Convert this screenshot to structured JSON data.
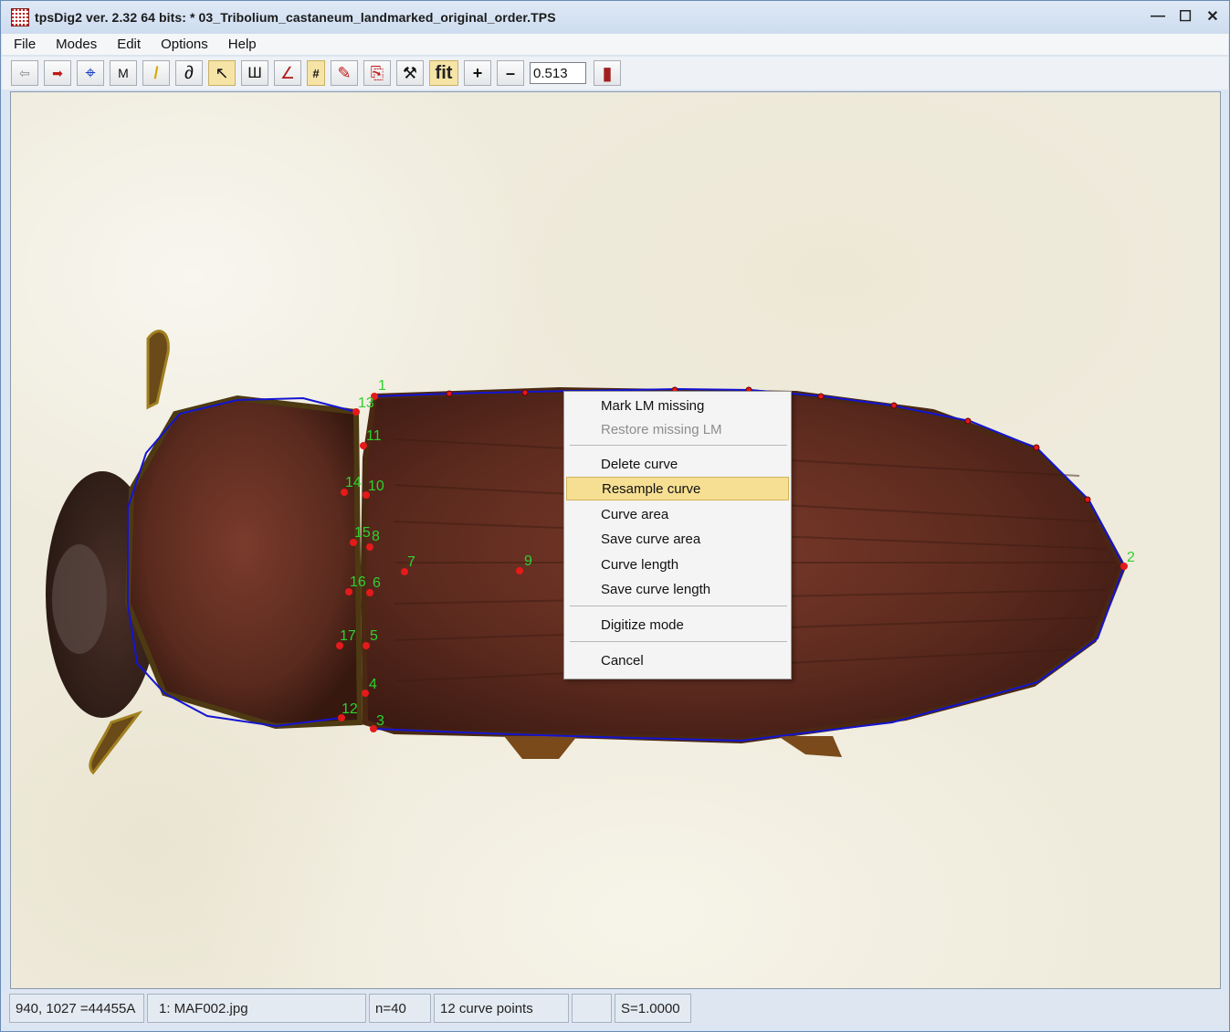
{
  "window": {
    "title": "tpsDig2 ver. 2.32 64 bits: * 03_Tribolium_castaneum_landmarked_original_order.TPS",
    "minimize": "—",
    "maximize": "☐",
    "close": "✕"
  },
  "menu": [
    "File",
    "Modes",
    "Edit",
    "Options",
    "Help"
  ],
  "toolbar": {
    "back_icon": "⇦",
    "forward_icon": "➡",
    "crosshair_icon": "⌖",
    "m_label": "M",
    "pen_icon": "/",
    "lasso_icon": "∂",
    "pointer_icon": "↖",
    "ruler_icon": "Ш",
    "angle_icon": "∠",
    "hash_label": "#",
    "brush_icon": "✎",
    "copy_icon": "⎘",
    "tool_icon": "⚒",
    "fit_label": "fit",
    "zoom_in_label": "+",
    "zoom_out_label": "–",
    "zoom_value": "0.513",
    "paint_icon": "▮"
  },
  "landmarks": [
    {
      "label": "1"
    },
    {
      "label": "2"
    },
    {
      "label": "3"
    },
    {
      "label": "4"
    },
    {
      "label": "5"
    },
    {
      "label": "6"
    },
    {
      "label": "7"
    },
    {
      "label": "8"
    },
    {
      "label": "9"
    },
    {
      "label": "10"
    },
    {
      "label": "11"
    },
    {
      "label": "12"
    },
    {
      "label": "13"
    },
    {
      "label": "14"
    },
    {
      "label": "15"
    },
    {
      "label": "16"
    },
    {
      "label": "17"
    }
  ],
  "context_menu": {
    "items": [
      {
        "label": "Mark LM missing",
        "enabled": true
      },
      {
        "label": "Restore missing LM",
        "enabled": false
      },
      {
        "label": "Delete curve",
        "enabled": true
      },
      {
        "label": "Resample curve",
        "enabled": true,
        "highlighted": true
      },
      {
        "label": "Curve area",
        "enabled": true
      },
      {
        "label": "Save curve area",
        "enabled": true
      },
      {
        "label": "Curve length",
        "enabled": true
      },
      {
        "label": "Save curve length",
        "enabled": true
      },
      {
        "label": "Digitize mode",
        "enabled": true
      },
      {
        "label": "Cancel",
        "enabled": true
      }
    ]
  },
  "status": {
    "coords": "940, 1027 =44455A",
    "image": "1: MAF002.jpg",
    "n": "n=40",
    "curve_points": "12 curve points",
    "empty": "",
    "scale": "S=1.0000"
  },
  "colors": {
    "curve": "#1414d2",
    "landmark": "#e51a1a",
    "landmark_label": "#2fd12f",
    "highlight": "#f6df93"
  }
}
